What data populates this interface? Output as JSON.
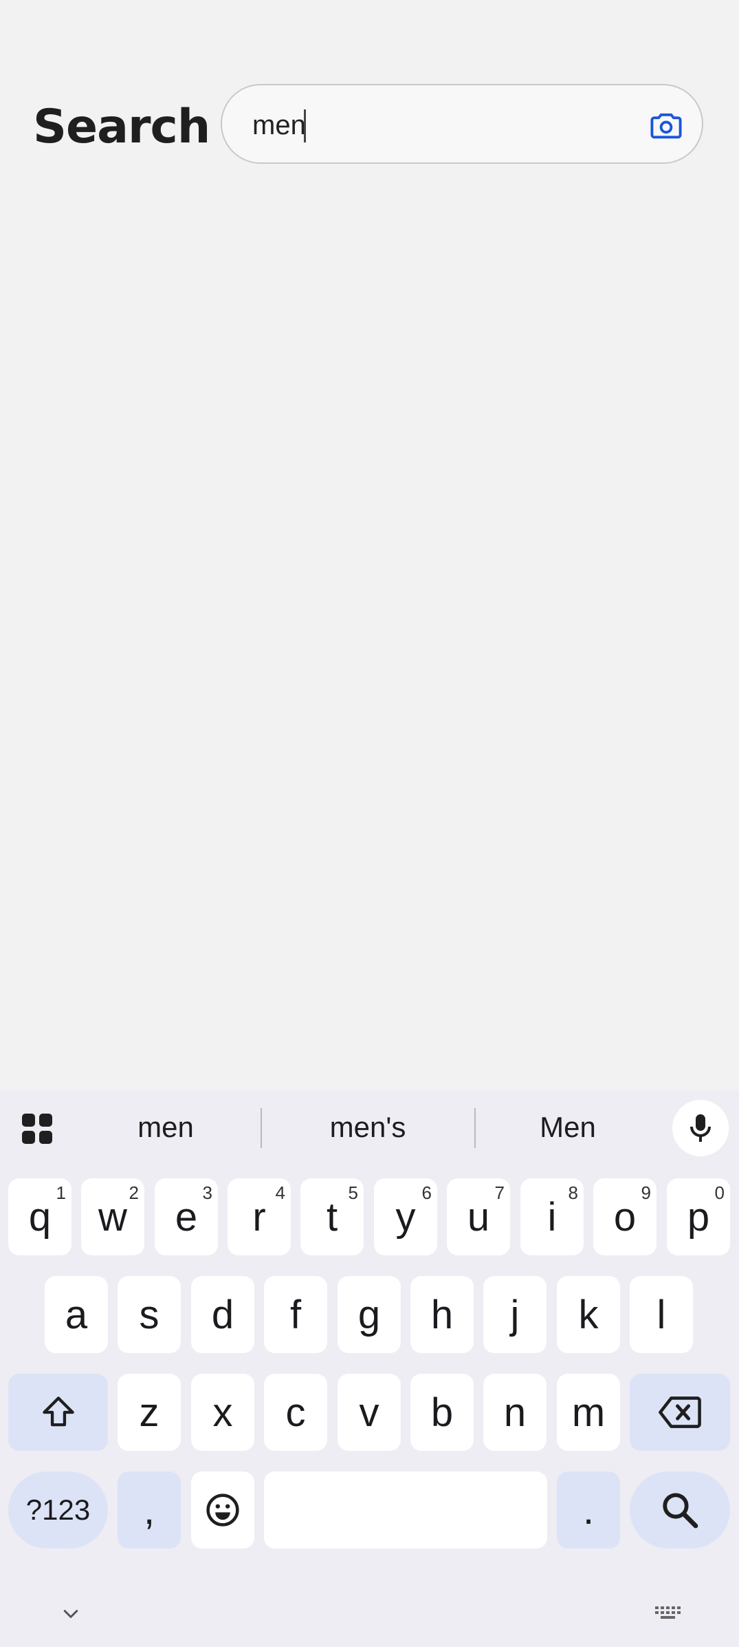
{
  "header": {
    "title": "Search"
  },
  "search": {
    "value": "men",
    "icon": "camera-icon"
  },
  "keyboard": {
    "suggestions": [
      "men",
      "men's",
      "Men"
    ],
    "row1": [
      {
        "key": "q",
        "hint": "1"
      },
      {
        "key": "w",
        "hint": "2"
      },
      {
        "key": "e",
        "hint": "3"
      },
      {
        "key": "r",
        "hint": "4"
      },
      {
        "key": "t",
        "hint": "5"
      },
      {
        "key": "y",
        "hint": "6"
      },
      {
        "key": "u",
        "hint": "7"
      },
      {
        "key": "i",
        "hint": "8"
      },
      {
        "key": "o",
        "hint": "9"
      },
      {
        "key": "p",
        "hint": "0"
      }
    ],
    "row2": [
      "a",
      "s",
      "d",
      "f",
      "g",
      "h",
      "j",
      "k",
      "l"
    ],
    "row3": [
      "z",
      "x",
      "c",
      "v",
      "b",
      "n",
      "m"
    ],
    "row4": {
      "symbols": "?123",
      "comma": ",",
      "period": "."
    },
    "accent_color": "#1a56db",
    "modifier_color": "#dde3f6"
  }
}
